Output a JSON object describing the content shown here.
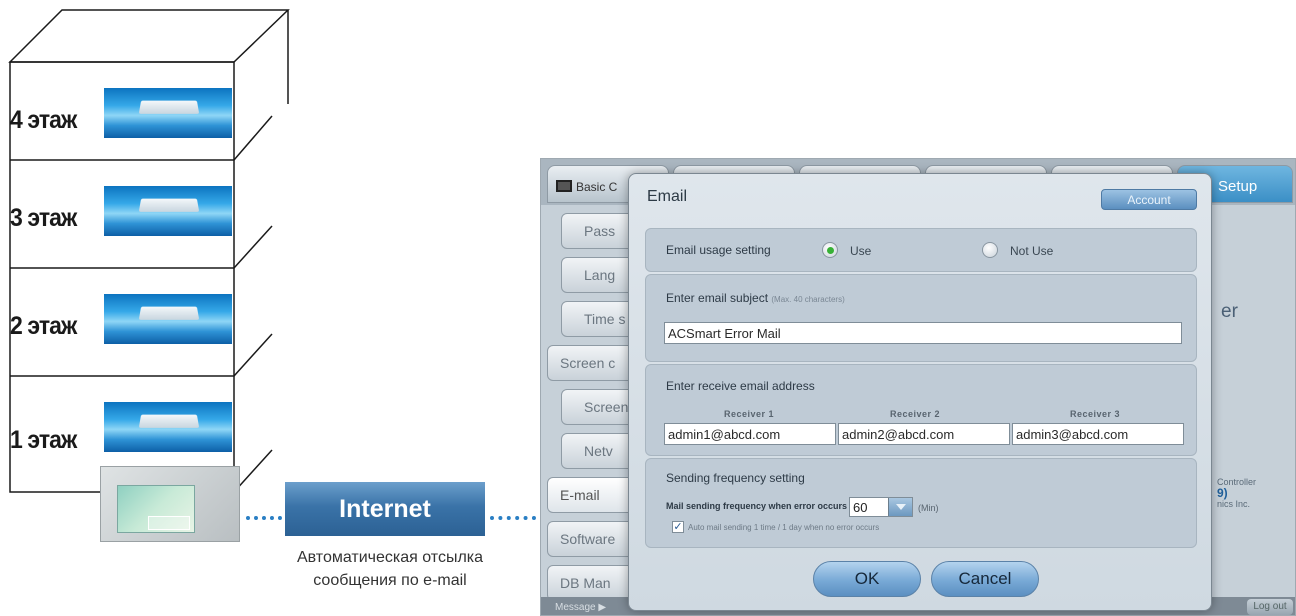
{
  "diagram": {
    "floors": [
      "4 этаж",
      "3 этаж",
      "2 этаж",
      "1 этаж"
    ],
    "internet_label": "Internet",
    "caption_line1": "Автоматическая отсылка",
    "caption_line2": "сообщения по e-mail"
  },
  "app": {
    "tabs": [
      "Basic C",
      "",
      "",
      "",
      "",
      "Setup"
    ],
    "sidebar": [
      "Pass",
      "Lang",
      "Time s",
      "Screen c",
      "Screen",
      "Netv",
      "E-mail",
      "Software",
      "DB Man"
    ],
    "right_text": "er",
    "info_line1": "Controller",
    "info_line2": "9)",
    "info_line3": "nics Inc.",
    "status_text": "Message ▶",
    "logout_label": "Log out"
  },
  "dialog": {
    "title": "Email",
    "account_button": "Account",
    "usage": {
      "label": "Email usage setting",
      "options": [
        "Use",
        "Not Use"
      ],
      "selected": "Use"
    },
    "subject": {
      "label": "Enter email subject",
      "hint": "(Max. 40 characters)",
      "value": "ACSmart Error Mail"
    },
    "receivers": {
      "label": "Enter receive email address",
      "headers": [
        "Receiver 1",
        "Receiver 2",
        "Receiver 3"
      ],
      "values": [
        "admin1@abcd.com",
        "admin2@abcd.com",
        "admin3@abcd.com"
      ]
    },
    "frequency": {
      "label": "Sending frequency setting",
      "field_label": "Mail sending frequency when error occurs :",
      "value": "60",
      "unit": "(Min)",
      "auto_checked": true,
      "auto_label": "Auto mail sending 1 time / 1 day when no error occurs"
    },
    "ok_button": "OK",
    "cancel_button": "Cancel"
  }
}
